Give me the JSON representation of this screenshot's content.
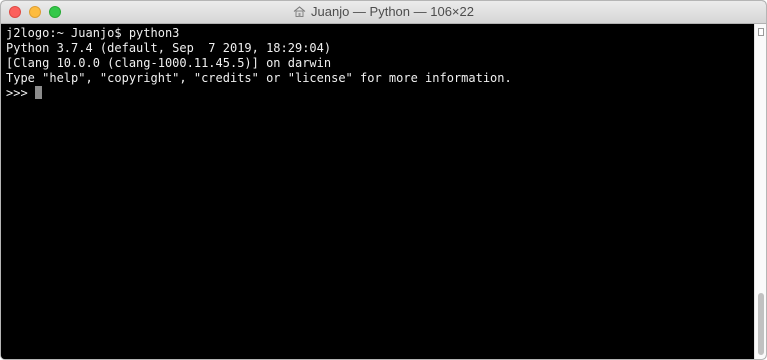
{
  "window": {
    "title": "Juanjo — Python — 106×22"
  },
  "terminal": {
    "lines": [
      "j2logo:~ Juanjo$ python3",
      "Python 3.7.4 (default, Sep  7 2019, 18:29:04)",
      "[Clang 10.0.0 (clang-1000.11.45.5)] on darwin",
      "Type \"help\", \"copyright\", \"credits\" or \"license\" for more information."
    ],
    "prompt": ">>>"
  },
  "colors": {
    "background": "#000000",
    "text": "#f0f0f0",
    "cursor": "#8c8c8c"
  },
  "icons": {
    "title_icon": "home-folder-icon"
  }
}
